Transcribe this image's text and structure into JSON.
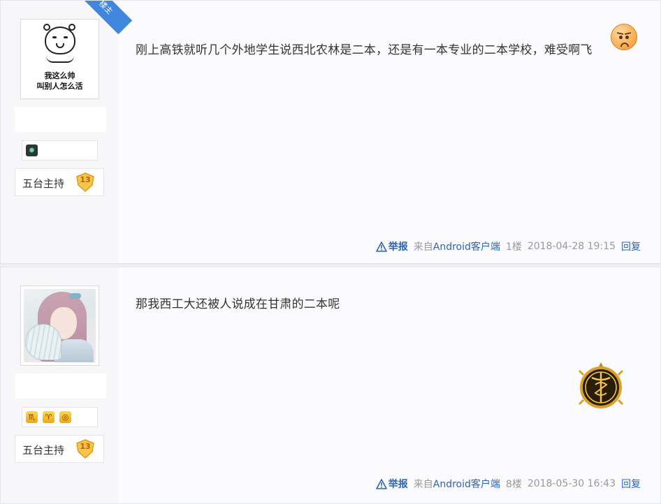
{
  "posts": [
    {
      "avatar_caption_line1": "我这么帅",
      "avatar_caption_line2": "叫别人怎么活",
      "author_badge": "楼主",
      "level_name": "五台主持",
      "level_number": "13",
      "content": "刚上高铁就听几个外地学生说西北农林是二本，还是有一本专业的二本学校，难受啊飞",
      "emoji": "frown-emoji",
      "report_label": "举报",
      "source_prefix": "来自",
      "source_client": "Android客户端",
      "floor": "1楼",
      "timestamp": "2018-04-28 19:15",
      "reply_label": "回复"
    },
    {
      "level_name": "五台主持",
      "level_number": "13",
      "content": "那我西工大还被人说成在甘肃的二本呢",
      "report_label": "举报",
      "source_prefix": "来自",
      "source_client": "Android客户端",
      "floor": "8楼",
      "timestamp": "2018-05-30 16:43",
      "reply_label": "回复"
    }
  ],
  "colors": {
    "link": "#2d64b3",
    "muted": "#999999",
    "badge_blue": "#3f86df",
    "level_gold": "#f6c54a"
  },
  "icons": [
    "warning-icon",
    "gem-icon",
    "scorpio-icon",
    "aries-icon",
    "ring-icon",
    "caduceus-medal-icon"
  ]
}
